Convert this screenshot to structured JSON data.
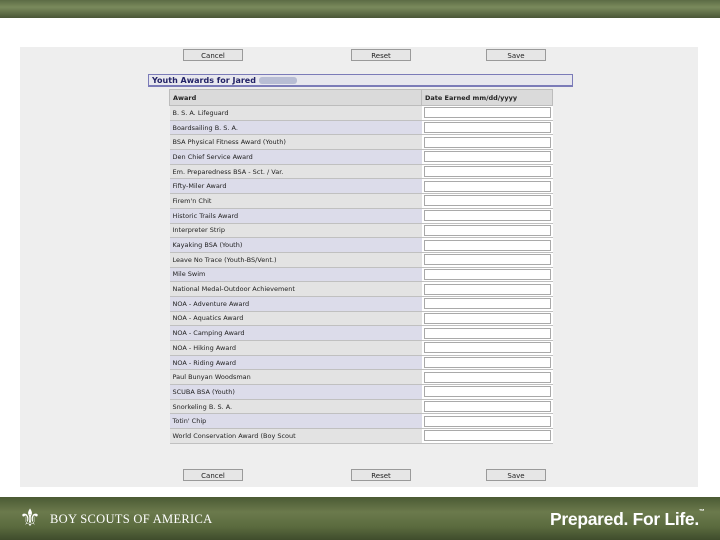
{
  "toolbar_top": {
    "cancel": "Cancel",
    "reset": "Reset",
    "save": "Save"
  },
  "toolbar_bottom": {
    "cancel": "Cancel",
    "reset": "Reset",
    "save": "Save"
  },
  "heading": {
    "title": "Youth Awards for Jared"
  },
  "table": {
    "columns": [
      "Award",
      "Date Earned mm/dd/yyyy"
    ],
    "rows": [
      "B. S. A. Lifeguard",
      "Boardsailing B. S. A.",
      "BSA Physical Fitness Award (Youth)",
      "Den Chief Service Award",
      "Em. Preparedness BSA - Sct. / Var.",
      "Fifty-Miler Award",
      "Firem'n Chit",
      "Historic Trails Award",
      "Interpreter Strip",
      "Kayaking BSA (Youth)",
      "Leave No Trace (Youth-BS/Vent.)",
      "Mile Swim",
      "National Medal-Outdoor Achievement",
      "NOA - Adventure Award",
      "NOA - Aquatics Award",
      "NOA - Camping Award",
      "NOA - Hiking Award",
      "NOA - Riding Award",
      "Paul Bunyan Woodsman",
      "SCUBA BSA (Youth)",
      "Snorkeling B. S. A.",
      "Totin' Chip",
      "World Conservation Award (Boy Scout"
    ]
  },
  "footer": {
    "org_name": "BOY SCOUTS OF AMERICA",
    "tagline": "Prepared. For Life.",
    "trademark": "™",
    "logo_icon": "fleur-de-lis-icon"
  },
  "colors": {
    "heading_border": "#7b7bb8",
    "band": "#5c6b45"
  }
}
